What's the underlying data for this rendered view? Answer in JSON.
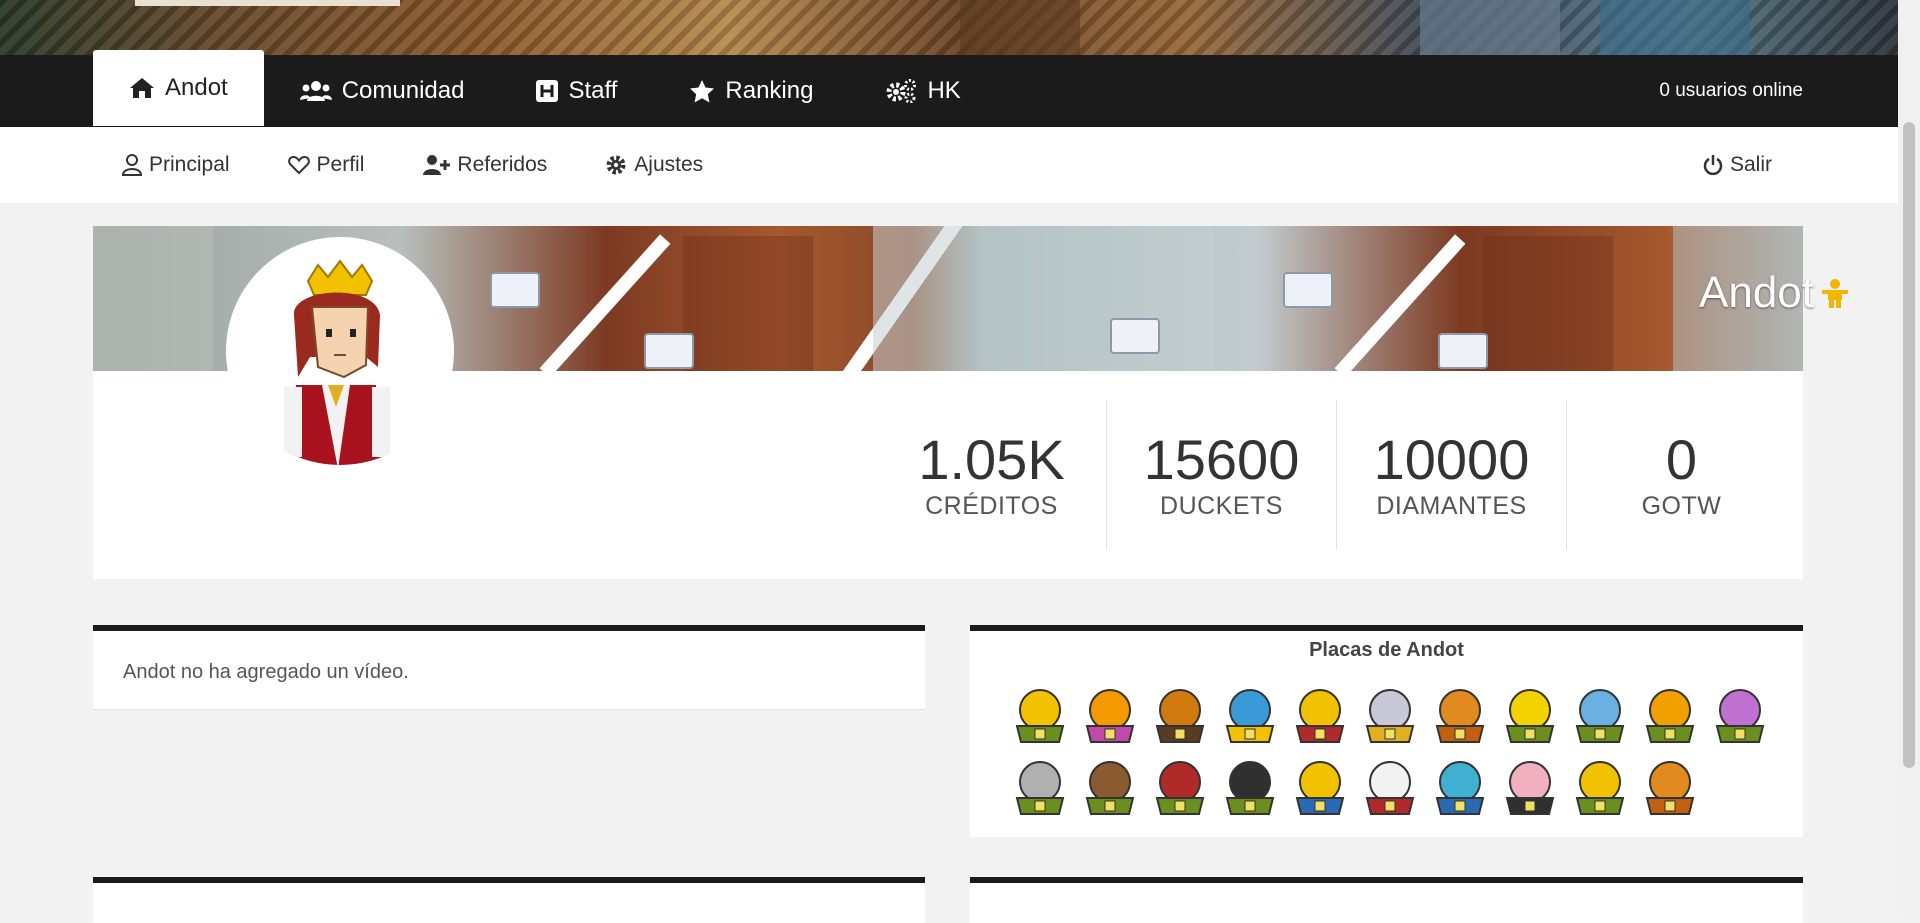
{
  "topnav": {
    "tabs": [
      {
        "label": "Andot",
        "icon": "home-icon",
        "active": true
      },
      {
        "label": "Comunidad",
        "icon": "users-icon",
        "active": false
      },
      {
        "label": "Staff",
        "icon": "hospital-icon",
        "active": false
      },
      {
        "label": "Ranking",
        "icon": "star-icon",
        "active": false
      },
      {
        "label": "HK",
        "icon": "cogs-icon",
        "active": false
      }
    ],
    "online": "0 usuarios online"
  },
  "subnav": {
    "items": [
      {
        "label": "Principal",
        "icon": "user-icon"
      },
      {
        "label": "Perfil",
        "icon": "heart-icon"
      },
      {
        "label": "Referidos",
        "icon": "user-plus-icon"
      },
      {
        "label": "Ajustes",
        "icon": "cog-icon"
      }
    ],
    "logout": "Salir"
  },
  "profile": {
    "username": "Andot",
    "stats": [
      {
        "value": "1.05K",
        "label": "CRÉDITOS"
      },
      {
        "value": "15600",
        "label": "DUCKETS"
      },
      {
        "value": "10000",
        "label": "DIAMANTES"
      },
      {
        "value": "0",
        "label": "GOTW"
      }
    ]
  },
  "video": {
    "message": "Andot no ha agregado un vídeo."
  },
  "badges": {
    "title": "Placas de Andot",
    "items": [
      {
        "colors": [
          "#f2c200",
          "#6a8f1e"
        ]
      },
      {
        "colors": [
          "#f29a00",
          "#c04aa8"
        ]
      },
      {
        "colors": [
          "#d07a10",
          "#5a3a20"
        ]
      },
      {
        "colors": [
          "#3a9ad8",
          "#f2c200"
        ]
      },
      {
        "colors": [
          "#f2c200",
          "#b02a2a"
        ]
      },
      {
        "colors": [
          "#c8c8d8",
          "#e0b020"
        ]
      },
      {
        "colors": [
          "#e08a20",
          "#c06010"
        ]
      },
      {
        "colors": [
          "#f2d200",
          "#6a8f1e"
        ]
      },
      {
        "colors": [
          "#6ab0e0",
          "#6a8f1e"
        ]
      },
      {
        "colors": [
          "#f2a000",
          "#6a8f1e"
        ]
      },
      {
        "colors": [
          "#c070d0",
          "#6a8f1e"
        ]
      },
      {
        "colors": [
          "#b0b0b0",
          "#6a8f1e"
        ]
      },
      {
        "colors": [
          "#8a5a30",
          "#6a8f1e"
        ]
      },
      {
        "colors": [
          "#b02a2a",
          "#6a8f1e"
        ]
      },
      {
        "colors": [
          "#303030",
          "#6a8f1e"
        ]
      },
      {
        "colors": [
          "#f2c200",
          "#2a6ab0"
        ]
      },
      {
        "colors": [
          "#f2f2f2",
          "#b02a2a"
        ]
      },
      {
        "colors": [
          "#40b0d0",
          "#2a6ab0"
        ]
      },
      {
        "colors": [
          "#f0b0c0",
          "#303030"
        ]
      },
      {
        "colors": [
          "#f2c200",
          "#6a8f1e"
        ]
      },
      {
        "colors": [
          "#e08a20",
          "#c06010"
        ]
      }
    ]
  }
}
